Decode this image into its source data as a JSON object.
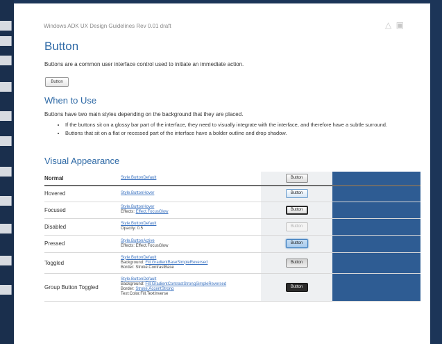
{
  "doc": {
    "header": "Windows ADK UX Design Guidelines  Rev 0.01 draft",
    "title": "Button",
    "intro": "Buttons are a common user interface control used to initiate an immediate action.",
    "sample_button": "Button"
  },
  "when": {
    "heading": "When to Use",
    "desc": "Buttons have two main styles depending on the background that they are placed.",
    "bullets": [
      "If the buttons sit on a glossy bar part of the interface, they need to visually integrate with the interface, and therefore have a subtle surround.",
      "Buttons that sit on a flat or recessed part of the interface have a bolder outline and drop shadow."
    ]
  },
  "visual": {
    "heading": "Visual Appearance",
    "rows": [
      {
        "state": "Normal",
        "style_link": "Style.ButtonDefault",
        "button": "Button"
      },
      {
        "state": "Hovered",
        "style_link": "Style.ButtonHover",
        "button": "Button"
      },
      {
        "state": "Focused",
        "style_link": "Style.ButtonHover",
        "effects_prefix": "Effects:",
        "effects_link": "Effect.FocusGlow",
        "button": "Button"
      },
      {
        "state": "Disabled",
        "style_link": "Style.ButtonDefault",
        "line2": "Opacity: 0.5",
        "button": "Button"
      },
      {
        "state": "Pressed",
        "style_link": "Style.ButtonActive",
        "line2": "Effects: Effect.FocusGlow",
        "button": "Button"
      },
      {
        "state": "Toggled",
        "style_link": "Style.ButtonDefault",
        "bg_prefix": "Background:",
        "bg_link": "Fill.GradientBaseSimpleReversed",
        "border_line": "Border: Stroke.ContrastBase",
        "button": "Button"
      },
      {
        "state": "Group Button Toggled",
        "style_link": "Style.ButtonDefault",
        "bg_prefix": "Background:",
        "bg_link": "Fill.GradientContrastStrongSimpleReversed",
        "border_prefix": "Border:",
        "border_link": "Stroke.AccentStrong",
        "text_line": "Text:Color.Fill.TextInverse",
        "button": "Button"
      }
    ]
  },
  "colors": {
    "accent": "#2f6aa6",
    "dark_column": "#2e5c93",
    "light_column": "#eef0f2",
    "backdrop": "#1c3558"
  },
  "icons": [
    "warning-triangle-icon",
    "share-box-icon"
  ]
}
